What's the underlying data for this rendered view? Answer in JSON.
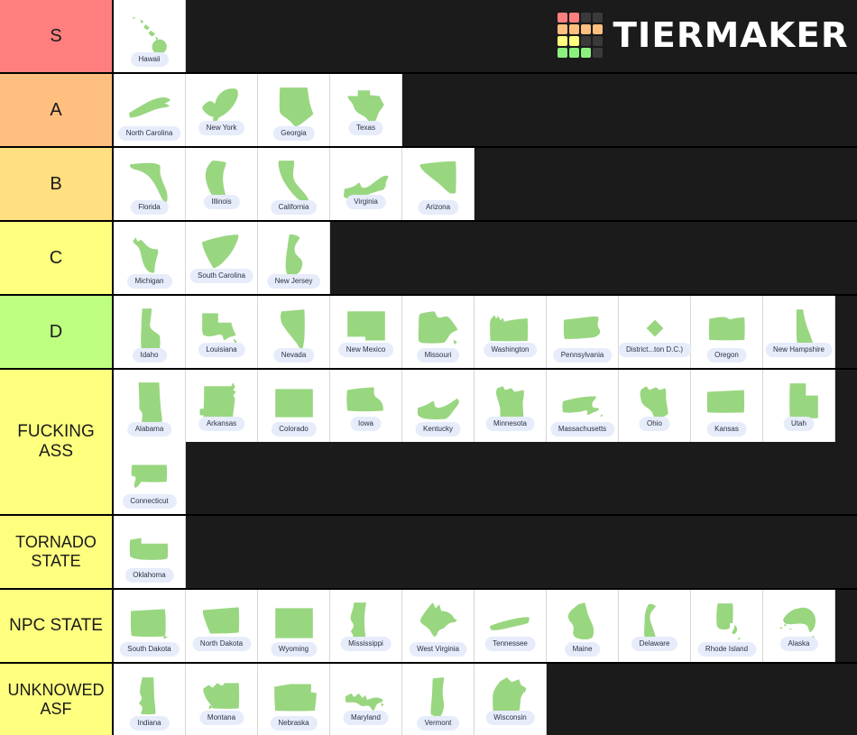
{
  "brand": {
    "name": "TIERMAKER",
    "logo_grid": [
      [
        "#ff7f7f",
        "#ff7f7f",
        "#3a3a3a",
        "#3a3a3a"
      ],
      [
        "#ffbf7f",
        "#ffbf7f",
        "#ffbf7f",
        "#ffbf7f"
      ],
      [
        "#ffff7f",
        "#ffff7f",
        "#3a3a3a",
        "#3a3a3a"
      ],
      [
        "#8cf07f",
        "#8cf07f",
        "#8cf07f",
        "#3a3a3a"
      ]
    ]
  },
  "colors": {
    "tier_s": "#ff7f7f",
    "tier_a": "#ffbf7f",
    "tier_b": "#ffdf7f",
    "tier_c": "#ffff7f",
    "tier_d": "#bfff7f",
    "tier_yellow": "#ffff7f",
    "background": "#1b1b1b",
    "tile_background": "#ffffff",
    "shape_fill": "#99d680",
    "caption_background": "#e7ecfa"
  },
  "tiers": [
    {
      "label": "S",
      "color": "#ff7f7f",
      "items": [
        {
          "name": "Hawaii",
          "icon": "state-hawaii-icon"
        }
      ]
    },
    {
      "label": "A",
      "color": "#ffbf7f",
      "items": [
        {
          "name": "North Carolina",
          "icon": "state-north-carolina-icon"
        },
        {
          "name": "New York",
          "icon": "state-new-york-icon"
        },
        {
          "name": "Georgia",
          "icon": "state-georgia-icon"
        },
        {
          "name": "Texas",
          "icon": "state-texas-icon"
        }
      ]
    },
    {
      "label": "B",
      "color": "#ffdf7f",
      "items": [
        {
          "name": "Florida",
          "icon": "state-florida-icon"
        },
        {
          "name": "Illinois",
          "icon": "state-illinois-icon"
        },
        {
          "name": "California",
          "icon": "state-california-icon"
        },
        {
          "name": "Virginia",
          "icon": "state-virginia-icon"
        },
        {
          "name": "Arizona",
          "icon": "state-arizona-icon"
        }
      ]
    },
    {
      "label": "C",
      "color": "#ffff7f",
      "items": [
        {
          "name": "Michigan",
          "icon": "state-michigan-icon"
        },
        {
          "name": "South Carolina",
          "icon": "state-south-carolina-icon"
        },
        {
          "name": "New Jersey",
          "icon": "state-new-jersey-icon"
        }
      ]
    },
    {
      "label": "D",
      "color": "#bfff7f",
      "items": [
        {
          "name": "Idaho",
          "icon": "state-idaho-icon"
        },
        {
          "name": "Louisiana",
          "icon": "state-louisiana-icon"
        },
        {
          "name": "Nevada",
          "icon": "state-nevada-icon"
        },
        {
          "name": "New Mexico",
          "icon": "state-new-mexico-icon"
        },
        {
          "name": "Missouri",
          "icon": "state-missouri-icon"
        },
        {
          "name": "Washington",
          "icon": "state-washington-icon"
        },
        {
          "name": "Pennsylvania",
          "icon": "state-pennsylvania-icon"
        },
        {
          "name": "District...ton D.C.)",
          "icon": "district-of-columbia-icon"
        },
        {
          "name": "Oregon",
          "icon": "state-oregon-icon"
        },
        {
          "name": "New Hampshire",
          "icon": "state-new-hampshire-icon"
        }
      ]
    },
    {
      "label": "FUCKING ASS",
      "color": "#ffff7f",
      "items": [
        {
          "name": "Alabama",
          "icon": "state-alabama-icon"
        },
        {
          "name": "Arkansas",
          "icon": "state-arkansas-icon"
        },
        {
          "name": "Colorado",
          "icon": "state-colorado-icon"
        },
        {
          "name": "Iowa",
          "icon": "state-iowa-icon"
        },
        {
          "name": "Kentucky",
          "icon": "state-kentucky-icon"
        },
        {
          "name": "Minnesota",
          "icon": "state-minnesota-icon"
        },
        {
          "name": "Massachusetts",
          "icon": "state-massachusetts-icon"
        },
        {
          "name": "Ohio",
          "icon": "state-ohio-icon"
        },
        {
          "name": "Kansas",
          "icon": "state-kansas-icon"
        },
        {
          "name": "Utah",
          "icon": "state-utah-icon"
        },
        {
          "name": "Connecticut",
          "icon": "state-connecticut-icon"
        }
      ]
    },
    {
      "label": "TORNADO STATE",
      "color": "#ffff7f",
      "items": [
        {
          "name": "Oklahoma",
          "icon": "state-oklahoma-icon"
        }
      ]
    },
    {
      "label": "NPC STATE",
      "color": "#ffff7f",
      "items": [
        {
          "name": "South Dakota",
          "icon": "state-south-dakota-icon"
        },
        {
          "name": "North Dakota",
          "icon": "state-north-dakota-icon"
        },
        {
          "name": "Wyoming",
          "icon": "state-wyoming-icon"
        },
        {
          "name": "Mississippi",
          "icon": "state-mississippi-icon"
        },
        {
          "name": "West Virginia",
          "icon": "state-west-virginia-icon"
        },
        {
          "name": "Tennessee",
          "icon": "state-tennessee-icon"
        },
        {
          "name": "Maine",
          "icon": "state-maine-icon"
        },
        {
          "name": "Delaware",
          "icon": "state-delaware-icon"
        },
        {
          "name": "Rhode Island",
          "icon": "state-rhode-island-icon"
        },
        {
          "name": "Alaska",
          "icon": "state-alaska-icon"
        }
      ]
    },
    {
      "label": "UNKNOWED ASF",
      "color": "#ffff7f",
      "items": [
        {
          "name": "Indiana",
          "icon": "state-indiana-icon"
        },
        {
          "name": "Montana",
          "icon": "state-montana-icon"
        },
        {
          "name": "Nebraska",
          "icon": "state-nebraska-icon"
        },
        {
          "name": "Maryland",
          "icon": "state-maryland-icon"
        },
        {
          "name": "Vermont",
          "icon": "state-vermont-icon"
        },
        {
          "name": "Wisconsin",
          "icon": "state-wisconsin-icon"
        }
      ]
    }
  ]
}
